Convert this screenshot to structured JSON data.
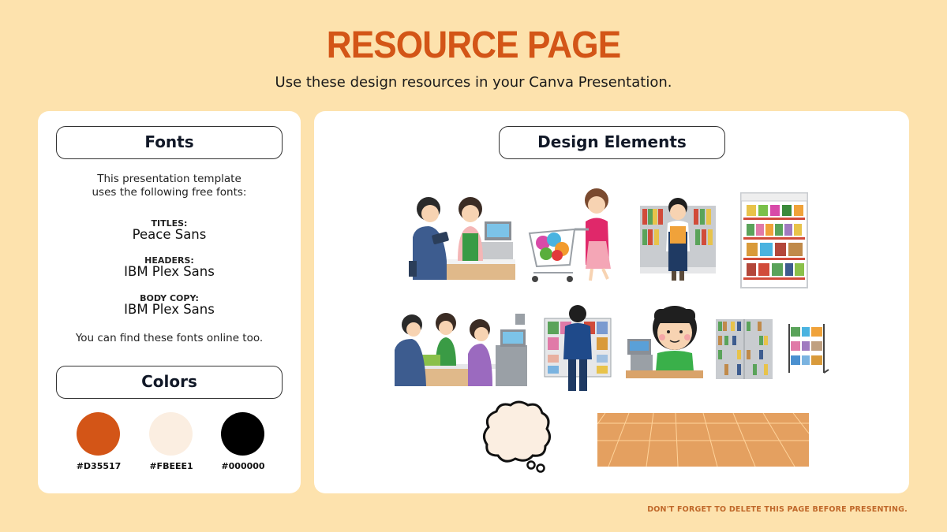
{
  "header": {
    "title": "RESOURCE PAGE",
    "subtitle": "Use these design resources in your Canva Presentation."
  },
  "fonts_panel": {
    "heading": "Fonts",
    "intro_line1": "This presentation template",
    "intro_line2": "uses the following free fonts:",
    "entries": [
      {
        "label": "TITLES:",
        "font": "Peace Sans"
      },
      {
        "label": "HEADERS:",
        "font": "IBM Plex Sans"
      },
      {
        "label": "BODY COPY:",
        "font": "IBM Plex Sans"
      }
    ],
    "outro": "You can find these fonts online too."
  },
  "colors_panel": {
    "heading": "Colors",
    "swatches": [
      {
        "hex": "#D35517",
        "color": "#D35517"
      },
      {
        "hex": "#FBEEE1",
        "color": "#FBEEE1"
      },
      {
        "hex": "#000000",
        "color": "#000000"
      }
    ]
  },
  "design_panel": {
    "heading": "Design Elements",
    "elements": [
      "cashier-with-customer-paying-by-phone",
      "woman-pushing-shopping-cart",
      "store-clerk-holding-book",
      "refrigerated-display-shelf",
      "checkout-line-with-self-register",
      "customer-browsing-magazine-rack",
      "cashier-at-register",
      "bookshelf",
      "magazine-rack",
      "thought-bubble",
      "tiled-floor"
    ]
  },
  "footer": {
    "note": "DON'T FORGET TO DELETE THIS PAGE BEFORE PRESENTING."
  }
}
